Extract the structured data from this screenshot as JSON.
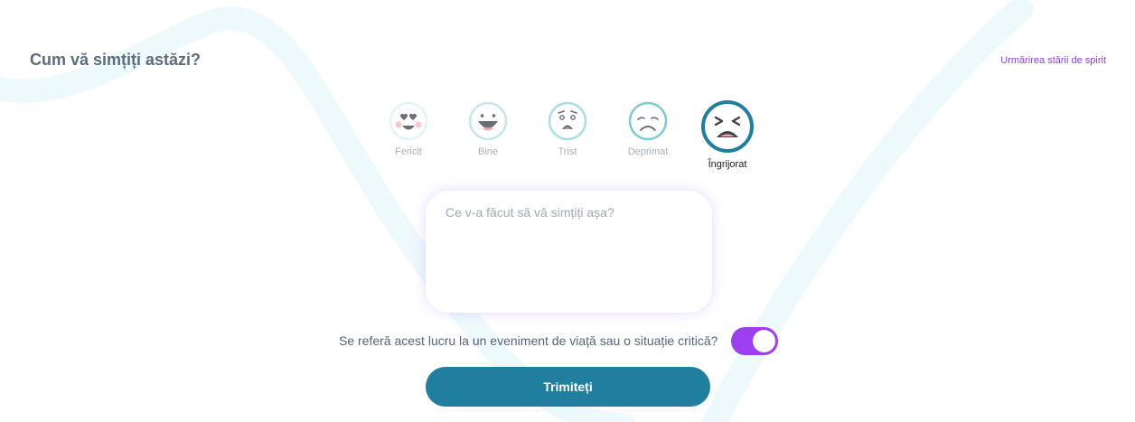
{
  "title": "Cum vă simțiți astăzi?",
  "mood_tracking_link": "Urmărirea stării de spirit",
  "moods": [
    {
      "label": "Fericit",
      "icon": "heart-eyes-face-icon"
    },
    {
      "label": "Bine",
      "icon": "grinning-face-icon"
    },
    {
      "label": "Trist",
      "icon": "worried-face-icon"
    },
    {
      "label": "Deprimat",
      "icon": "sad-face-icon"
    },
    {
      "label": "Îngrijorat",
      "icon": "anguished-face-icon",
      "selected": true
    }
  ],
  "note": {
    "placeholder": "Ce v-a făcut să vă simțiți așa?",
    "value": ""
  },
  "critical_event": {
    "question": "Se referă acest lucru la un eveniment de viață sau o situație critică?",
    "enabled": true
  },
  "submit_label": "Trimiteți",
  "colors": {
    "accent": "#9b3ff0",
    "submit": "#207f9e",
    "title": "#5b6b80",
    "mood_ring": "#b9e3e6",
    "selected_ring": "#207f9e"
  }
}
